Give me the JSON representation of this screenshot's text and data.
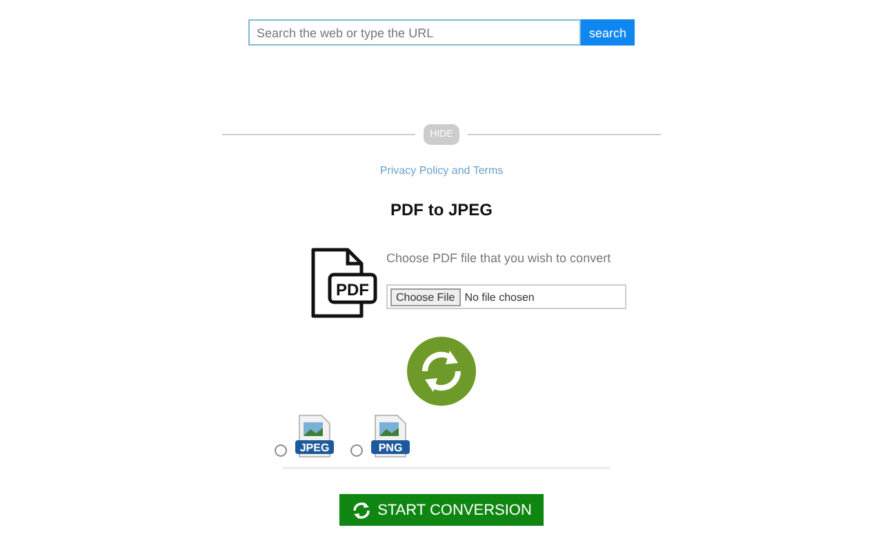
{
  "search": {
    "placeholder": "Search the web or type the URL",
    "button": "search"
  },
  "hide_button": "HIDE",
  "privacy_link": "Privacy Policy and Terms",
  "title": "PDF to JPEG",
  "upload": {
    "icon_label": "PDF",
    "prompt": "Choose PDF file that you wish to convert",
    "choose_button": "Choose File",
    "status": "No file chosen"
  },
  "formats": [
    {
      "label": "JPEG",
      "selected": false
    },
    {
      "label": "PNG",
      "selected": false
    }
  ],
  "start_button": "START CONVERSION"
}
